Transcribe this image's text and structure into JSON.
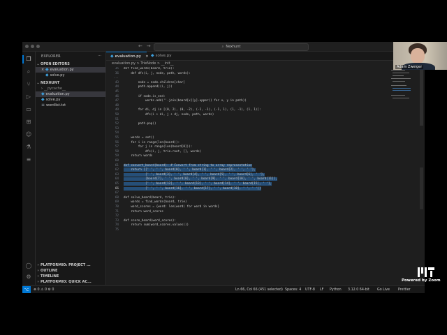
{
  "window": {
    "search_text": "Nexhunt"
  },
  "sidebar": {
    "title": "EXPLORER",
    "more": "···",
    "open_editors_label": "OPEN EDITORS",
    "open_editors": [
      {
        "name": "evaluation.py",
        "selected": true,
        "close": "×"
      },
      {
        "name": "solve.py",
        "selected": false,
        "close": ""
      }
    ],
    "folder_label": "NEXHUNT",
    "files": [
      {
        "name": "__pycache__",
        "kind": "folder"
      },
      {
        "name": "evaluation.py",
        "kind": "py",
        "selected": true
      },
      {
        "name": "solve.py",
        "kind": "py"
      },
      {
        "name": "wordlist.txt",
        "kind": "txt"
      }
    ],
    "bottom_sections": [
      "PLATFORMIO: PROJECT ...",
      "OUTLINE",
      "TIMELINE",
      "PLATFORMIO: QUICK AC..."
    ]
  },
  "tabs": [
    {
      "label": "evaluation.py",
      "active": true,
      "close": "×"
    },
    {
      "label": "solve.py",
      "active": false
    }
  ],
  "breadcrumb": "evaluation.py  >  TrieNode  >  __init__",
  "code_lines": [
    {
      "n": "35",
      "t": "def find_words(board, trie):"
    },
    {
      "n": "36",
      "t": "    def dfs(i, j, node, path, words):"
    },
    {
      "n": "...",
      "t": ""
    },
    {
      "n": "43",
      "t": "        node = node.children[char]"
    },
    {
      "n": "44",
      "t": "        path.append((i, j))"
    },
    {
      "n": "45",
      "t": ""
    },
    {
      "n": "46",
      "t": "        if node.is_end:"
    },
    {
      "n": "47",
      "t": "            words.add(''.join(board[x][y].upper() for x, y in path))"
    },
    {
      "n": "48",
      "t": ""
    },
    {
      "n": "49",
      "t": "        for di, dj in [(0, 2), (0, -2), (-1, -1), (-1, 1), (1, -1), (1, 1)]:"
    },
    {
      "n": "50",
      "t": "            dfs(i + di, j + dj, node, path, words)"
    },
    {
      "n": "51",
      "t": ""
    },
    {
      "n": "52",
      "t": "        path.pop()"
    },
    {
      "n": "53",
      "t": ""
    },
    {
      "n": "54",
      "t": ""
    },
    {
      "n": "55",
      "t": "    words = set()"
    },
    {
      "n": "56",
      "t": "    for i in range(len(board)):"
    },
    {
      "n": "57",
      "t": "        for j in range(len(board[0])):"
    },
    {
      "n": "58",
      "t": "            dfs(i, j, trie.root, [], words)"
    },
    {
      "n": "59",
      "t": "    return words"
    },
    {
      "n": "60",
      "t": ""
    },
    {
      "n": "61",
      "t": "def convert_board(board): # Convert from string to array representation"
    },
    {
      "n": "62",
      "t": "    return [[' ', ' ', board[0], ' ', board[1], ' ', board[2], ' ', ' '],"
    },
    {
      "n": "63",
      "t": "            [' ', board[3], ' ', board[4], ' ', board[5], ' ', board[6], ' '],"
    },
    {
      "n": "64",
      "t": "            [board[7], ' ', board[8], ' ', board[9], ' ', board[10], ' ', board[11]],"
    },
    {
      "n": "65",
      "t": "            [' ', board[12], ' ', board[13], ' ', board[14], ' ', board[15], ' '],"
    },
    {
      "n": "66",
      "t": "            [' ', ' ', board[16], ' ', board[17], ' ', board[18], ' ', ' ']]"
    },
    {
      "n": "67",
      "t": ""
    },
    {
      "n": "68",
      "t": "def solve_board(board, trie):"
    },
    {
      "n": "69",
      "t": "    words = find_words(board, trie)"
    },
    {
      "n": "70",
      "t": "    word_scores = {word: len(word) for word in words}"
    },
    {
      "n": "71",
      "t": "    return word_scores"
    },
    {
      "n": "72",
      "t": ""
    },
    {
      "n": "73",
      "t": "def score_board(word_scores):"
    },
    {
      "n": "74",
      "t": "    return sum(word_scores.values())"
    },
    {
      "n": "75",
      "t": ""
    }
  ],
  "status": {
    "left": "⊗ 0 ⚠ 0   ⚙ 0",
    "position": "Ln 66, Col 66 (451 selected)",
    "spaces": "Spaces: 4",
    "encoding": "UTF-8",
    "eol": "LF",
    "language": "Python",
    "interpreter": "3.12.0 64-bit",
    "golive": "Go Live",
    "prettier": "Prettier"
  },
  "camera": {
    "name": "Adam Zweiger"
  },
  "branding": {
    "powered_by": "Powered by Zoom"
  },
  "colors": {
    "accent": "#0078d4",
    "selection": "#264f78",
    "editor_bg": "#1e1e1e"
  }
}
